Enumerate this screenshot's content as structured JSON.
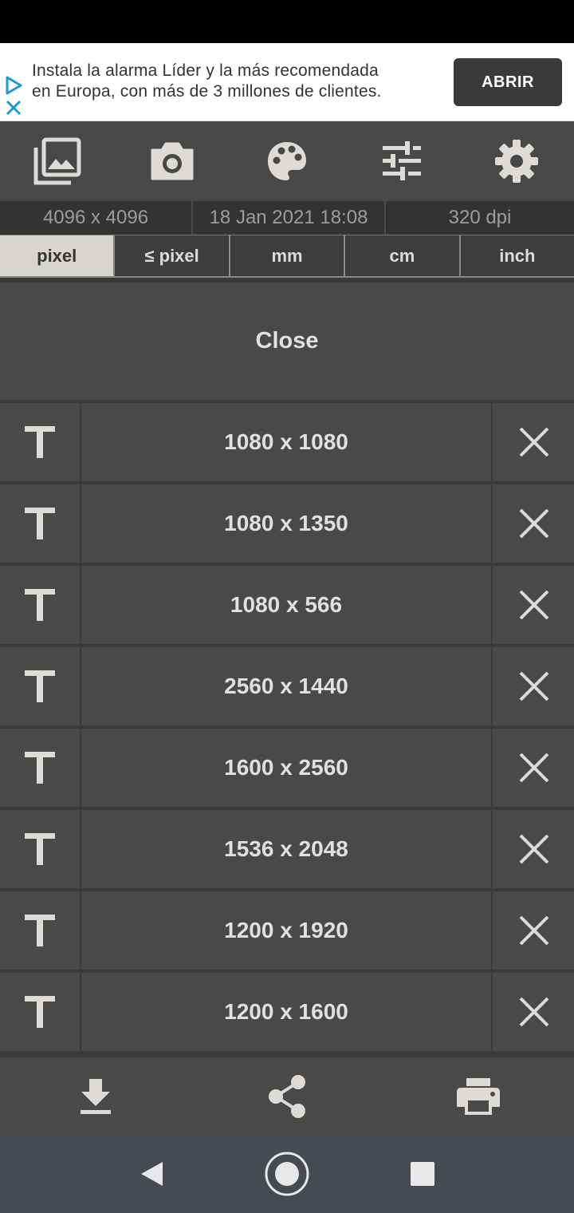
{
  "ad": {
    "text_line1": "Instala la alarma Líder y la más recomendada",
    "text_line2": "en Europa, con más de 3 millones de clientes.",
    "button_label": "ABRIR"
  },
  "toolbar": {
    "icons": [
      "gallery-icon",
      "camera-icon",
      "palette-icon",
      "tune-icon",
      "settings-icon"
    ]
  },
  "info": {
    "dimensions": "4096 x 4096",
    "date": "18 Jan 2021 18:08",
    "dpi": "320 dpi"
  },
  "units": {
    "items": [
      "pixel",
      "≤ pixel",
      "mm",
      "cm",
      "inch"
    ],
    "active": "pixel"
  },
  "close_label": "Close",
  "sizes": [
    "1080 x 1080",
    "1080 x 1350",
    "1080 x 566",
    "2560 x 1440",
    "1600 x 2560",
    "1536 x 2048",
    "1200 x 1920",
    "1200 x 1600"
  ],
  "colors": {
    "background": "#3a3a3a",
    "row": "#494949",
    "active_unit": "#d8d4cf",
    "icon": "#dedad5",
    "ad_accent": "#1a73e8"
  }
}
